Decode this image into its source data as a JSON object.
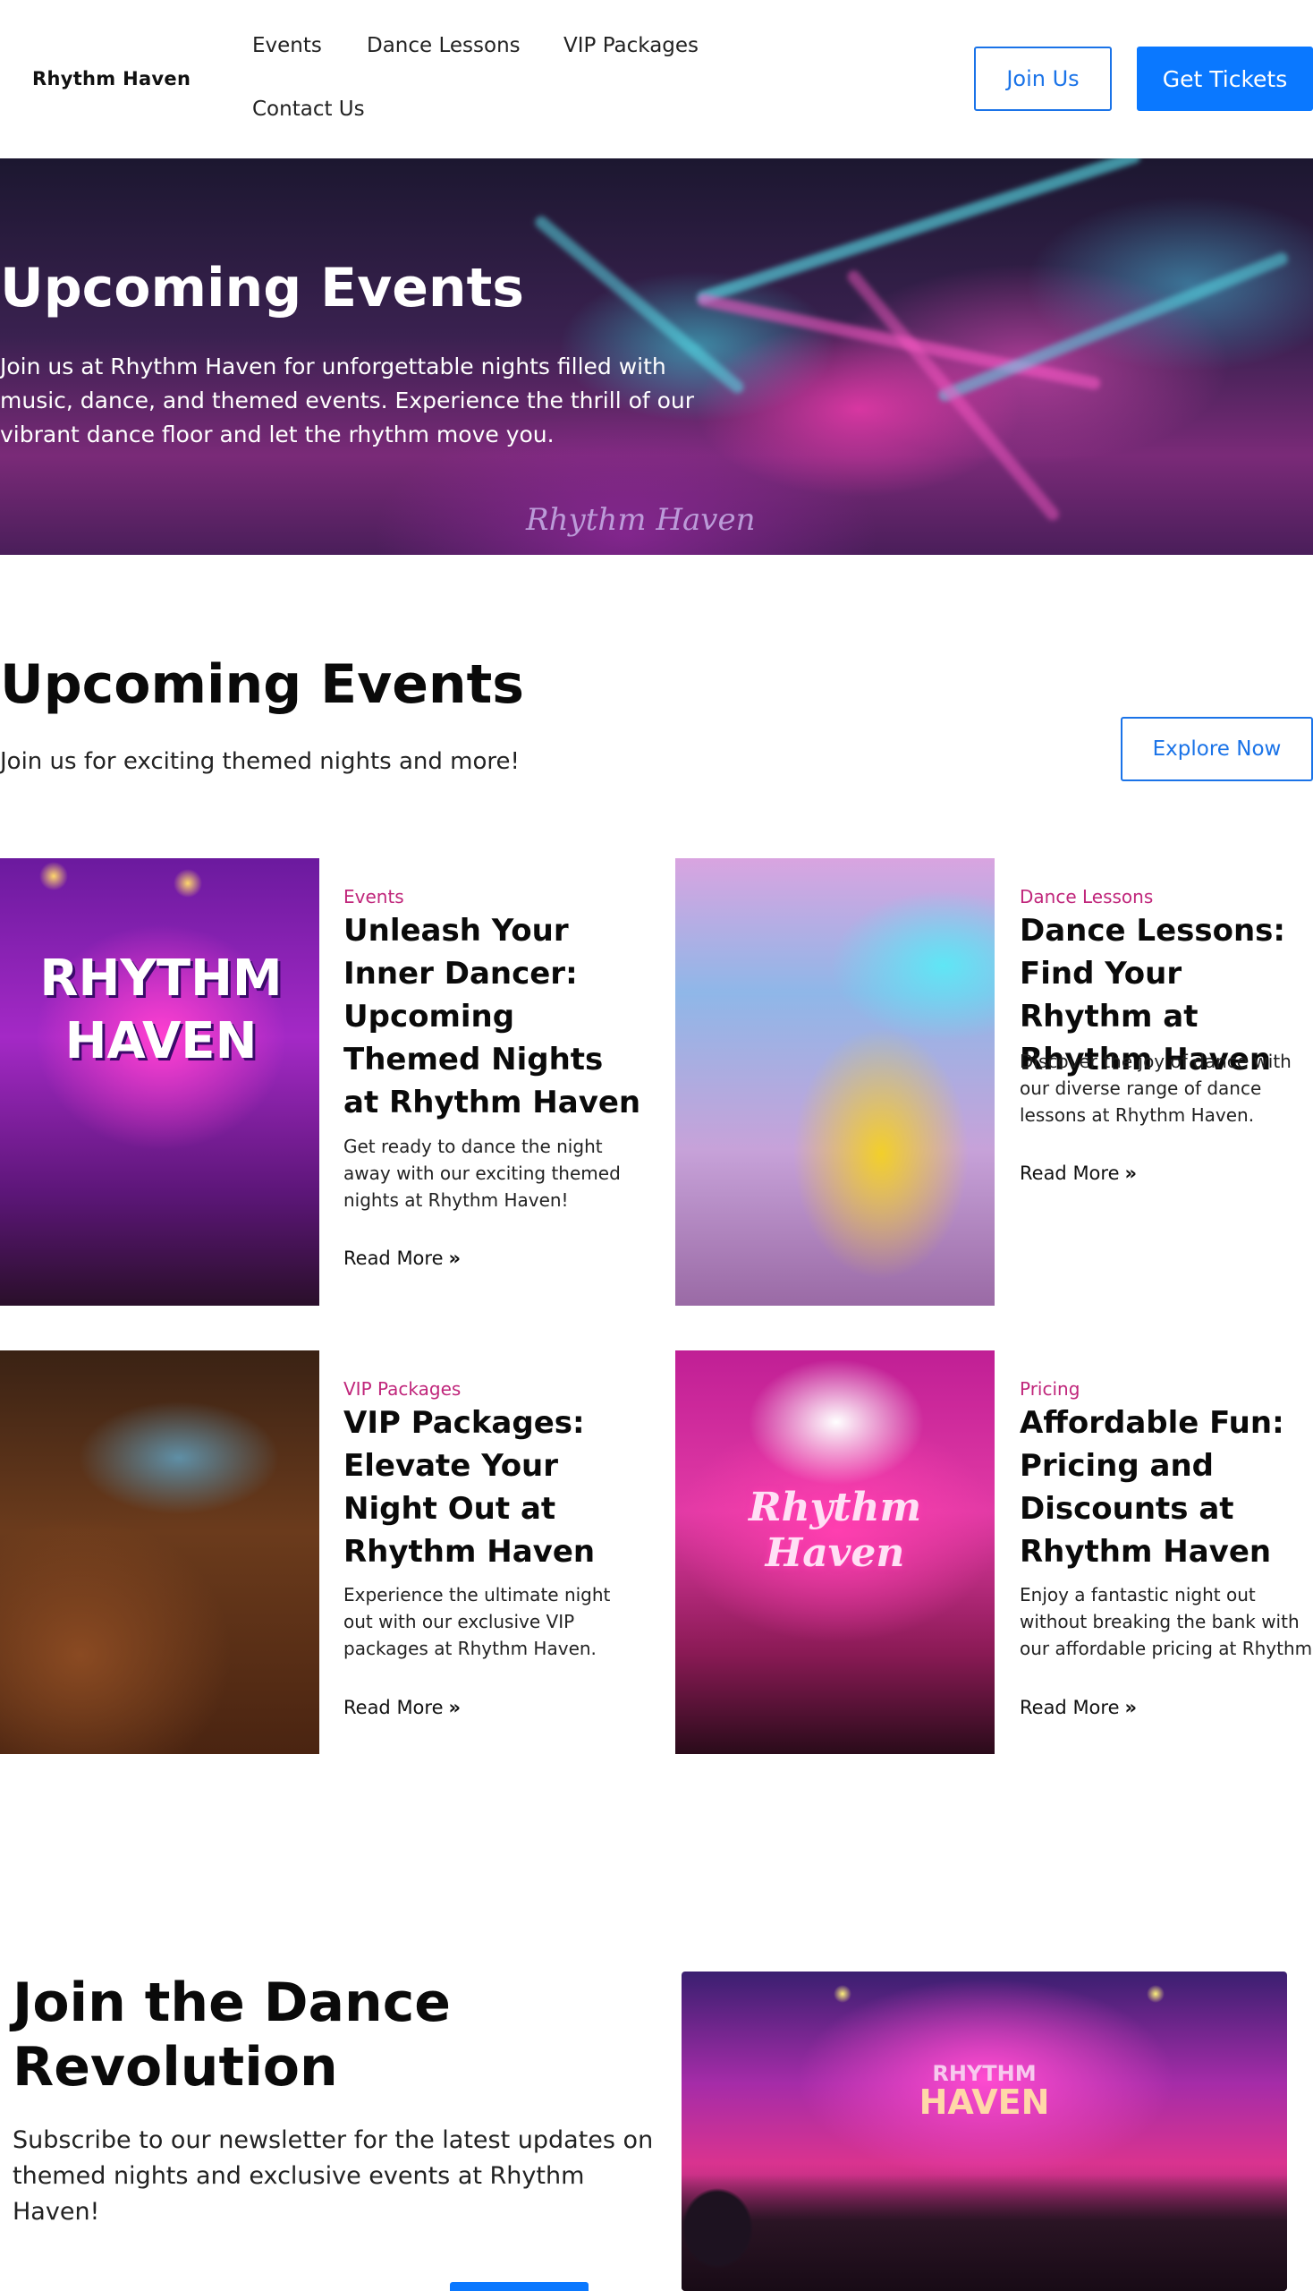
{
  "header": {
    "logo": "Rhythm Haven",
    "nav": [
      "Events",
      "Dance Lessons",
      "VIP Packages",
      "Contact Us"
    ],
    "join_label": "Join Us",
    "tickets_label": "Get Tickets"
  },
  "hero": {
    "title": "Upcoming Events",
    "text": "Join us at Rhythm Haven for unforgettable nights filled with music, dance, and themed events. Experience the thrill of our vibrant dance floor and let the rhythm move you.",
    "sign": "Rhythm Haven"
  },
  "events": {
    "title": "Upcoming Events",
    "subtitle": "Join us for exciting themed nights and more!",
    "explore_label": "Explore Now",
    "read_more": "Read More",
    "posts": [
      {
        "category": "Events",
        "title": "Unleash Your Inner Dancer: Upcoming Themed Nights at Rhythm Haven",
        "excerpt": "Get ready to dance the night away with our exciting themed nights at Rhythm Haven!",
        "image_text": "RHYTHM HAVEN"
      },
      {
        "category": "Dance Lessons",
        "title": "Dance Lessons: Find Your Rhythm at Rhythm Haven",
        "excerpt": "Discover the joy of dance with our diverse range of dance lessons at Rhythm Haven."
      },
      {
        "category": "VIP Packages",
        "title": "VIP Packages: Elevate Your Night Out at Rhythm Haven",
        "excerpt": "Experience the ultimate night out with our exclusive VIP packages at Rhythm Haven."
      },
      {
        "category": "Pricing",
        "title": "Affordable Fun: Pricing and Discounts at Rhythm Haven",
        "excerpt": "Enjoy a fantastic night out without breaking the bank with our affordable pricing at Rhythm",
        "image_text": "Rhythm Haven"
      }
    ]
  },
  "newsletter": {
    "title": "Join the Dance Revolution",
    "text": "Subscribe to our newsletter for the latest updates on themed nights and exclusive events at Rhythm Haven!",
    "image_text_top": "RHYTHM",
    "image_text_bottom": "HAVEN"
  },
  "colors": {
    "accent": "#0a78ff",
    "category": "#c0267b",
    "text": "#111111"
  }
}
